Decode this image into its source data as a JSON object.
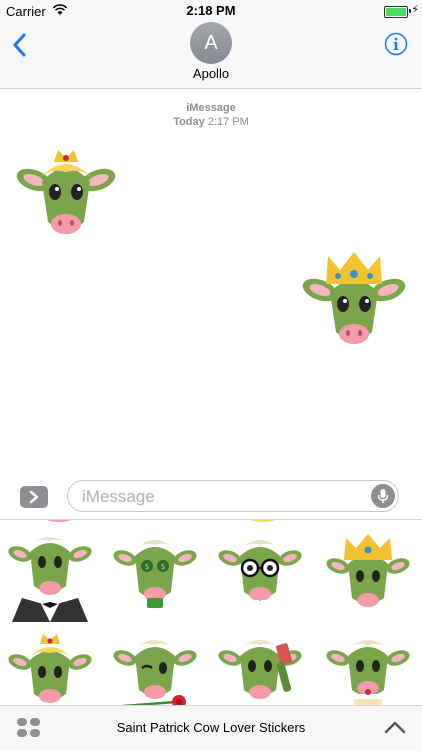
{
  "status_bar": {
    "carrier": "Carrier",
    "time": "2:18 PM"
  },
  "nav": {
    "avatar_initial": "A",
    "contact_name": "Apollo"
  },
  "conversation": {
    "service": "iMessage",
    "day": "Today",
    "time": "2:17 PM"
  },
  "input": {
    "placeholder": "iMessage"
  },
  "app_drawer": {
    "title": "Saint Patrick Cow Lover Stickers"
  },
  "colors": {
    "accent": "#157efb",
    "cow_green": "#7ba54a",
    "cow_dark": "#5a8a35",
    "ear_pink": "#f3b4c0",
    "snout_pink": "#f59aa8",
    "gold": "#f2c230",
    "jewel_red": "#c6262e",
    "jewel_blue": "#3a8fd3",
    "hair_blond": "#f5d85a"
  },
  "stickers_sent": [
    {
      "name": "cow-with-blond-hair-and-tiara"
    },
    {
      "name": "cow-with-gold-crown"
    }
  ],
  "drawer_stickers": [
    {
      "name": "cow-in-tuxedo"
    },
    {
      "name": "cow-with-coins-eyes"
    },
    {
      "name": "cow-with-glasses"
    },
    {
      "name": "cow-with-crown"
    },
    {
      "name": "cow-blond-tiara"
    },
    {
      "name": "cow-with-rose"
    },
    {
      "name": "cow-with-phone"
    },
    {
      "name": "cow-with-cake"
    }
  ]
}
